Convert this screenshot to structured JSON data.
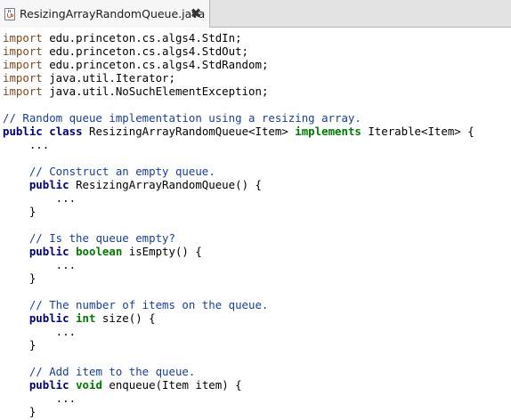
{
  "tab": {
    "title": "ResizingArrayRandomQueue.java",
    "icon": "java-file-icon",
    "close_label": "✖"
  },
  "colors": {
    "modifier_keyword": "#00007a",
    "type_keyword": "#007a00",
    "comment": "#1a3f8f",
    "import_keyword": "#7a4a1e",
    "plain": "#000000"
  },
  "code_lines": [
    [
      [
        "imp",
        "import"
      ],
      [
        "plain",
        " edu.princeton.cs.algs4.StdIn;"
      ]
    ],
    [
      [
        "imp",
        "import"
      ],
      [
        "plain",
        " edu.princeton.cs.algs4.StdOut;"
      ]
    ],
    [
      [
        "imp",
        "import"
      ],
      [
        "plain",
        " edu.princeton.cs.algs4.StdRandom;"
      ]
    ],
    [
      [
        "imp",
        "import"
      ],
      [
        "plain",
        " java.util.Iterator;"
      ]
    ],
    [
      [
        "imp",
        "import"
      ],
      [
        "plain",
        " java.util.NoSuchElementException;"
      ]
    ],
    [],
    [
      [
        "cmt",
        "// Random queue implementation using a resizing array."
      ]
    ],
    [
      [
        "mod",
        "public"
      ],
      [
        "plain",
        " "
      ],
      [
        "mod",
        "class"
      ],
      [
        "plain",
        " ResizingArrayRandomQueue<Item> "
      ],
      [
        "type",
        "implements"
      ],
      [
        "plain",
        " Iterable<Item> {"
      ]
    ],
    [
      [
        "plain",
        "    ..."
      ]
    ],
    [],
    [
      [
        "plain",
        "    "
      ],
      [
        "cmt",
        "// Construct an empty queue."
      ]
    ],
    [
      [
        "plain",
        "    "
      ],
      [
        "mod",
        "public"
      ],
      [
        "plain",
        " ResizingArrayRandomQueue() {"
      ]
    ],
    [
      [
        "plain",
        "        ..."
      ]
    ],
    [
      [
        "plain",
        "    }"
      ]
    ],
    [],
    [
      [
        "plain",
        "    "
      ],
      [
        "cmt",
        "// Is the queue empty?"
      ]
    ],
    [
      [
        "plain",
        "    "
      ],
      [
        "mod",
        "public"
      ],
      [
        "plain",
        " "
      ],
      [
        "type",
        "boolean"
      ],
      [
        "plain",
        " isEmpty() {"
      ]
    ],
    [
      [
        "plain",
        "        ..."
      ]
    ],
    [
      [
        "plain",
        "    }"
      ]
    ],
    [],
    [
      [
        "plain",
        "    "
      ],
      [
        "cmt",
        "// The number of items on the queue."
      ]
    ],
    [
      [
        "plain",
        "    "
      ],
      [
        "mod",
        "public"
      ],
      [
        "plain",
        " "
      ],
      [
        "type",
        "int"
      ],
      [
        "plain",
        " size() {"
      ]
    ],
    [
      [
        "plain",
        "        ..."
      ]
    ],
    [
      [
        "plain",
        "    }"
      ]
    ],
    [],
    [
      [
        "plain",
        "    "
      ],
      [
        "cmt",
        "// Add item to the queue."
      ]
    ],
    [
      [
        "plain",
        "    "
      ],
      [
        "mod",
        "public"
      ],
      [
        "plain",
        " "
      ],
      [
        "type",
        "void"
      ],
      [
        "plain",
        " enqueue(Item item) {"
      ]
    ],
    [
      [
        "plain",
        "        ..."
      ]
    ],
    [
      [
        "plain",
        "    }"
      ]
    ]
  ]
}
